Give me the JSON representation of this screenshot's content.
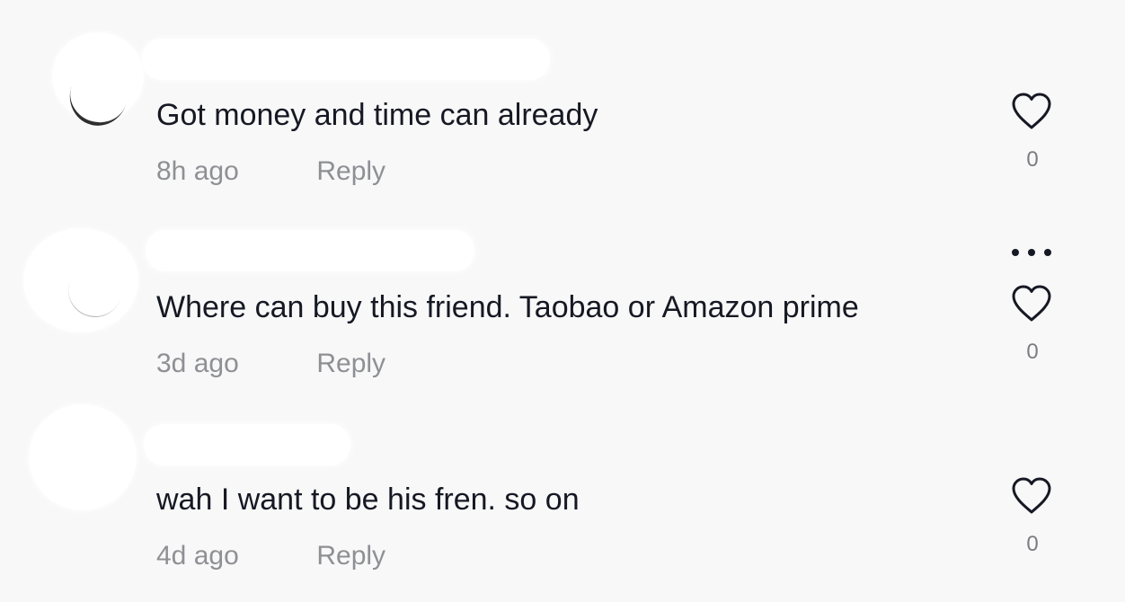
{
  "comments": [
    {
      "text": "Got money and time can already",
      "time": "8h ago",
      "reply_label": "Reply",
      "likes": "0"
    },
    {
      "text": "Where can buy this friend. Taobao or Amazon prime",
      "time": "3d ago",
      "reply_label": "Reply",
      "likes": "0"
    },
    {
      "text": "wah I want to be his fren. so on",
      "time": "4d ago",
      "reply_label": "Reply",
      "likes": "0"
    }
  ],
  "icons": {
    "like": "heart-icon",
    "more": "more-options-icon"
  },
  "colors": {
    "background": "#f8f8f8",
    "text": "#161823",
    "secondary_text": "#8f9095",
    "likes_text": "#7b7c82",
    "redaction": "#ffffff"
  }
}
